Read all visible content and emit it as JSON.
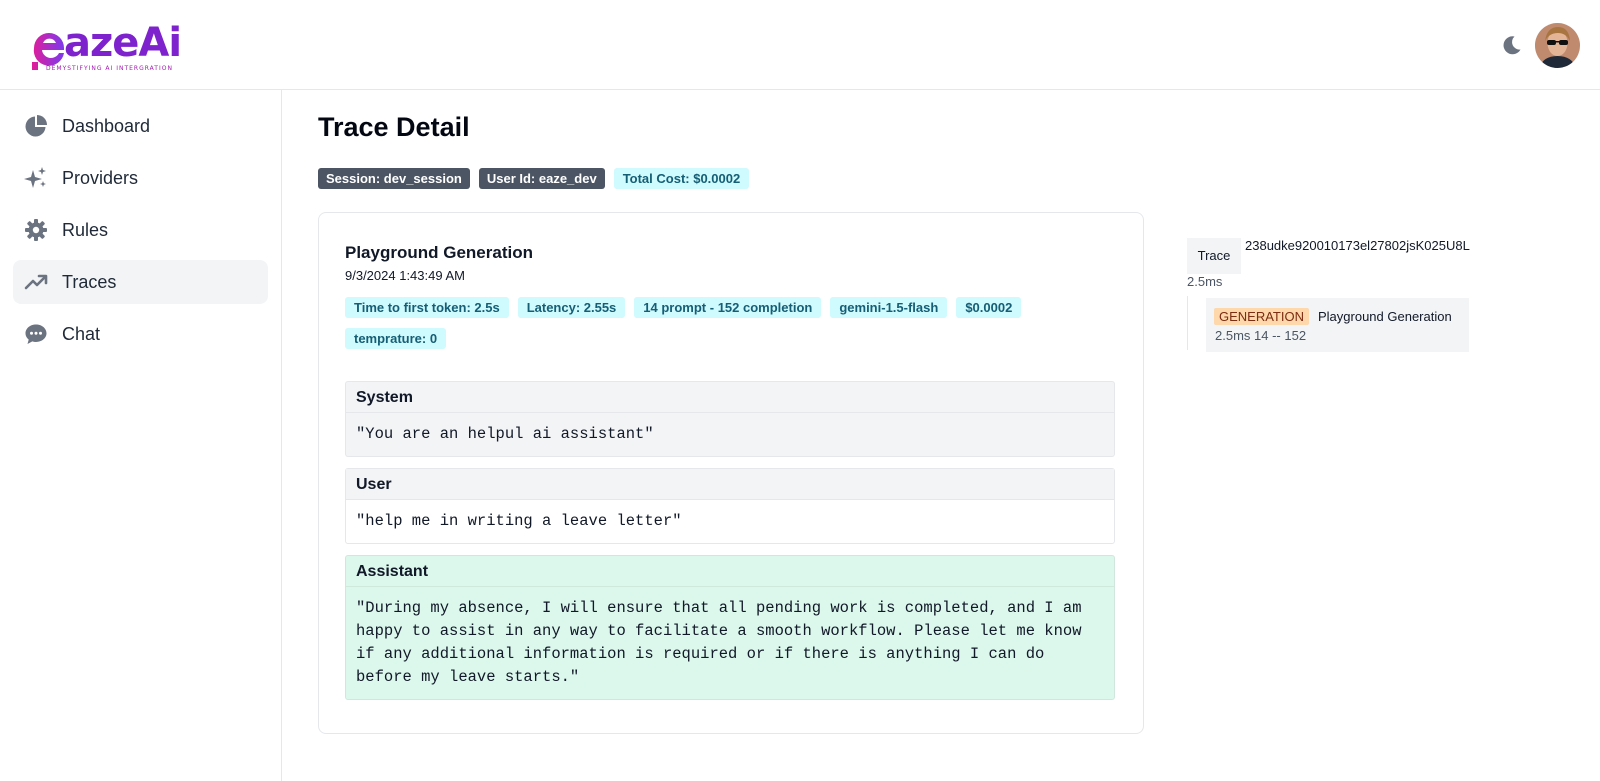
{
  "brand": {
    "name": "eazeAi",
    "tagline": "DEMYSTIFYING AI INTERGRATION"
  },
  "header": {
    "theme_icon": "moon-icon",
    "avatar_icon": "user-avatar"
  },
  "sidebar": {
    "items": [
      {
        "label": "Dashboard",
        "icon": "pie-chart-icon"
      },
      {
        "label": "Providers",
        "icon": "sparkles-icon"
      },
      {
        "label": "Rules",
        "icon": "gear-icon"
      },
      {
        "label": "Traces",
        "icon": "trending-up-icon",
        "active": true
      },
      {
        "label": "Chat",
        "icon": "chat-bubble-icon"
      }
    ]
  },
  "page": {
    "title": "Trace Detail",
    "badges": {
      "session": "Session: dev_session",
      "user": "User Id: eaze_dev",
      "cost": "Total Cost: $0.0002"
    }
  },
  "generation": {
    "title": "Playground Generation",
    "timestamp": "9/3/2024 1:43:49 AM",
    "meta": [
      "Time to first token: 2.5s",
      "Latency: 2.55s",
      "14 prompt - 152 completion",
      "gemini-1.5-flash",
      "$0.0002",
      "temprature: 0"
    ],
    "messages": {
      "system": {
        "role": "System",
        "content": "\"You are an helpul ai assistant\""
      },
      "user": {
        "role": "User",
        "content": "\"help me in writing a leave letter\""
      },
      "assistant": {
        "role": "Assistant",
        "content": "\"During my absence, I will ensure that all pending work is completed, and I am happy to assist in any way to facilitate a smooth workflow. Please let me know if any additional information is required or if there is anything I can do before my leave starts.\""
      }
    }
  },
  "trace_tree": {
    "label": "Trace",
    "id": "238udke920010173el27802jsK025U8L",
    "duration": "2.5ms",
    "node": {
      "type": "GENERATION",
      "name": "Playground Generation",
      "stats": "2.5ms 14 -- 152"
    }
  }
}
